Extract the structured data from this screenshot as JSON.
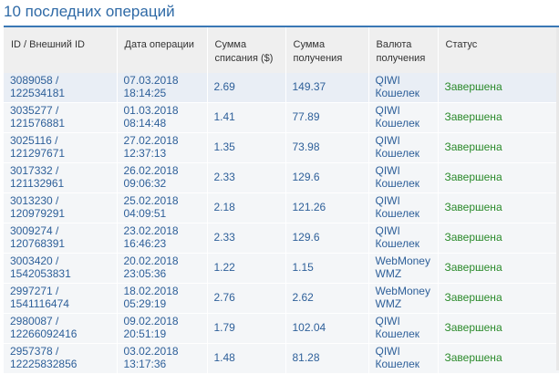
{
  "title": "10 последних операций",
  "columns": {
    "id": "ID / Внешний ID",
    "date": "Дата операции",
    "sum_write_off_1": "Сумма",
    "sum_write_off_2": "списания ($)",
    "sum_receive_1": "Сумма",
    "sum_receive_2": "получения",
    "currency_1": "Валюта",
    "currency_2": "получения",
    "status": "Статус"
  },
  "rows": [
    {
      "id": "3089058 /",
      "ext_id": "122534181",
      "date": "07.03.2018",
      "time": "18:14:25",
      "sum": "2.69",
      "recv": "149.37",
      "cur1": "QIWI",
      "cur2": "Кошелек",
      "status": "Завершена"
    },
    {
      "id": "3035277 /",
      "ext_id": "121576881",
      "date": "01.03.2018",
      "time": "08:14:48",
      "sum": "1.41",
      "recv": "77.89",
      "cur1": "QIWI",
      "cur2": "Кошелек",
      "status": "Завершена"
    },
    {
      "id": "3025116 /",
      "ext_id": "121297671",
      "date": "27.02.2018",
      "time": "12:37:13",
      "sum": "1.35",
      "recv": "73.98",
      "cur1": "QIWI",
      "cur2": "Кошелек",
      "status": "Завершена"
    },
    {
      "id": "3017332 /",
      "ext_id": "121132961",
      "date": "26.02.2018",
      "time": "09:06:32",
      "sum": "2.33",
      "recv": "129.6",
      "cur1": "QIWI",
      "cur2": "Кошелек",
      "status": "Завершена"
    },
    {
      "id": "3013230 /",
      "ext_id": "120979291",
      "date": "25.02.2018",
      "time": "04:09:51",
      "sum": "2.18",
      "recv": "121.26",
      "cur1": "QIWI",
      "cur2": "Кошелек",
      "status": "Завершена"
    },
    {
      "id": "3009274 /",
      "ext_id": "120768391",
      "date": "23.02.2018",
      "time": "16:46:23",
      "sum": "2.33",
      "recv": "129.6",
      "cur1": "QIWI",
      "cur2": "Кошелек",
      "status": "Завершена"
    },
    {
      "id": "3003420 /",
      "ext_id": "1542053831",
      "date": "20.02.2018",
      "time": "23:05:36",
      "sum": "1.22",
      "recv": "1.15",
      "cur1": "WebMoney",
      "cur2": "WMZ",
      "status": "Завершена"
    },
    {
      "id": "2997271 /",
      "ext_id": "1541116474",
      "date": "18.02.2018",
      "time": "05:29:19",
      "sum": "2.76",
      "recv": "2.62",
      "cur1": "WebMoney",
      "cur2": "WMZ",
      "status": "Завершена"
    },
    {
      "id": "2980087 /",
      "ext_id": "12266092416",
      "date": "09.02.2018",
      "time": "20:51:19",
      "sum": "1.79",
      "recv": "102.04",
      "cur1": "QIWI",
      "cur2": "Кошелек",
      "status": "Завершена"
    },
    {
      "id": "2957378 /",
      "ext_id": "12225832856",
      "date": "03.02.2018",
      "time": "13:17:36",
      "sum": "1.48",
      "recv": "81.28",
      "cur1": "QIWI",
      "cur2": "Кошелек",
      "status": "Завершена"
    }
  ],
  "colors": {
    "title": "#2f6aa6",
    "header_bg": "#efefef",
    "link": "#2d5f99",
    "status_done": "#2a8a2a",
    "accent_border": "#3a78b5"
  }
}
